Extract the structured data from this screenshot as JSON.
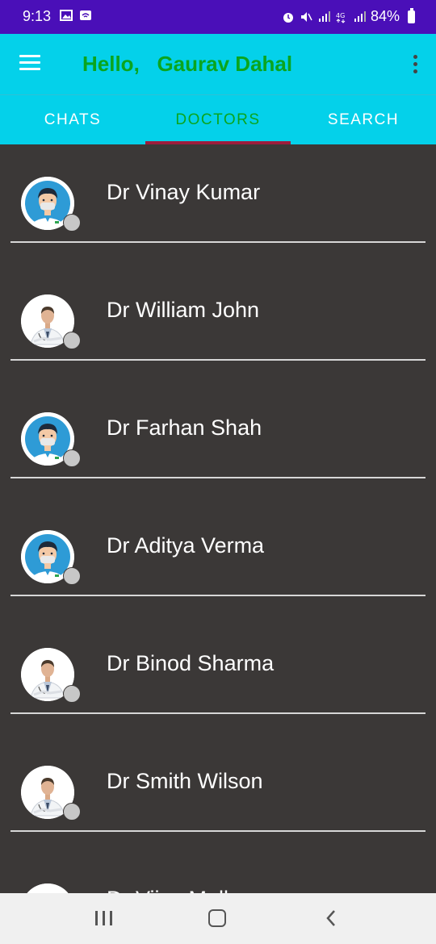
{
  "status_bar": {
    "time": "9:13",
    "battery": "84%",
    "left_icons": [
      "gallery-icon",
      "cast-icon"
    ],
    "right_icons": [
      "alarm-icon",
      "mute-icon",
      "signal-icon",
      "4g-icon",
      "signal-icon",
      "battery-icon"
    ]
  },
  "app_bar": {
    "title": "Hello,   Gaurav Dahal",
    "background": "#04d1ea",
    "title_color": "#0aa51e"
  },
  "tabs": [
    {
      "label": "CHATS",
      "active": false
    },
    {
      "label": "DOCTORS",
      "active": true
    },
    {
      "label": "SEARCH",
      "active": false
    }
  ],
  "doctors": [
    {
      "name": "Dr Vinay Kumar",
      "avatar": "cartoon-doctor"
    },
    {
      "name": "Dr William John",
      "avatar": "photo-doctor"
    },
    {
      "name": "Dr Farhan Shah",
      "avatar": "cartoon-doctor"
    },
    {
      "name": "Dr Aditya Verma",
      "avatar": "cartoon-doctor"
    },
    {
      "name": "Dr Binod Sharma",
      "avatar": "photo-doctor"
    },
    {
      "name": "Dr Smith Wilson",
      "avatar": "photo-doctor"
    },
    {
      "name": "Dr Vijay Malla",
      "avatar": "photo-doctor"
    }
  ],
  "colors": {
    "status_bar": "#4a0fb8",
    "list_background": "#3b3837",
    "tab_indicator": "#9c1d3c",
    "offline_dot": "#c7c7c7"
  }
}
